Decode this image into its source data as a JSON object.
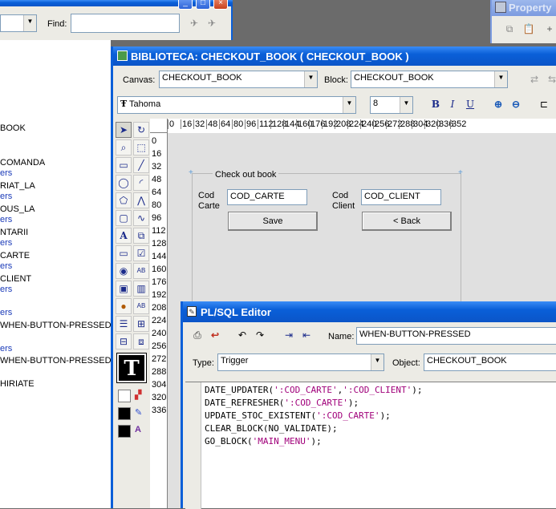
{
  "top_window": {
    "find_label": "Find:",
    "combo_value": "",
    "find_value": ""
  },
  "property_window": {
    "title": "Property"
  },
  "navigator": {
    "items": [
      {
        "text": "BOOK",
        "color": "black"
      },
      {
        "text": "COMANDA",
        "color": "black"
      },
      {
        "text": "ers",
        "color": "blue"
      },
      {
        "text": "RIAT_LA",
        "color": "black"
      },
      {
        "text": "ers",
        "color": "blue"
      },
      {
        "text": "OUS_LA",
        "color": "black"
      },
      {
        "text": "ers",
        "color": "blue"
      },
      {
        "text": "NTARII",
        "color": "black"
      },
      {
        "text": "ers",
        "color": "blue"
      },
      {
        "text": "CARTE",
        "color": "black"
      },
      {
        "text": "ers",
        "color": "blue"
      },
      {
        "text": "CLIENT",
        "color": "black"
      },
      {
        "text": "ers",
        "color": "blue"
      },
      {
        "text": "ers",
        "color": "blue"
      },
      {
        "text": "WHEN-BUTTON-PRESSED",
        "color": "black"
      },
      {
        "text": "ers",
        "color": "blue"
      },
      {
        "text": "WHEN-BUTTON-PRESSED",
        "color": "black"
      },
      {
        "text": "HIRIATE",
        "color": "black"
      }
    ]
  },
  "layout_editor": {
    "title": "BIBLIOTECA: CHECKOUT_BOOK ( CHECKOUT_BOOK )",
    "canvas_label": "Canvas:",
    "canvas_value": "CHECKOUT_BOOK",
    "block_label": "Block:",
    "block_value": "CHECKOUT_BOOK",
    "font_name": "Tahoma",
    "font_size": "8",
    "bold": "B",
    "italic": "I",
    "underline": "U",
    "ruler_h": [
      "0",
      "16",
      "32",
      "48",
      "64",
      "80",
      "96",
      "112",
      "128",
      "144",
      "160",
      "176",
      "192",
      "208",
      "224",
      "240",
      "256",
      "272",
      "288",
      "304",
      "320",
      "336",
      "352"
    ],
    "ruler_v": [
      "0",
      "16",
      "32",
      "48",
      "64",
      "80",
      "96",
      "112",
      "128",
      "144",
      "160",
      "176",
      "192",
      "208",
      "224",
      "240",
      "256",
      "272",
      "288",
      "304",
      "320",
      "336"
    ],
    "form": {
      "frame_title": "Check out book",
      "cod_carte_label_1": "Cod",
      "cod_carte_label_2": "Carte",
      "cod_carte_value": "COD_CARTE",
      "cod_client_label_1": "Cod",
      "cod_client_label_2": "Client",
      "cod_client_value": "COD_CLIENT",
      "save_button": "Save",
      "back_button": "< Back"
    }
  },
  "plsql_editor": {
    "title": "PL/SQL Editor",
    "name_label": "Name:",
    "name_value": "WHEN-BUTTON-PRESSED",
    "type_label": "Type:",
    "type_value": "Trigger",
    "object_label": "Object:",
    "object_value": "CHECKOUT_BOOK",
    "code_lines": [
      [
        {
          "t": "DATE_UPDATER(",
          "s": false
        },
        {
          "t": "':COD_CARTE'",
          "s": true
        },
        {
          "t": ",",
          "s": false
        },
        {
          "t": "':COD_CLIENT'",
          "s": true
        },
        {
          "t": ");",
          "s": false
        }
      ],
      [
        {
          "t": "DATE_REFRESHER(",
          "s": false
        },
        {
          "t": "':COD_CARTE'",
          "s": true
        },
        {
          "t": ");",
          "s": false
        }
      ],
      [
        {
          "t": "UPDATE_STOC_EXISTENT(",
          "s": false
        },
        {
          "t": "':COD_CARTE'",
          "s": true
        },
        {
          "t": ");",
          "s": false
        }
      ],
      [
        {
          "t": "CLEAR_BLOCK(NO_VALIDATE);",
          "s": false
        }
      ],
      [
        {
          "t": "GO_BLOCK(",
          "s": false
        },
        {
          "t": "'MAIN_MENU'",
          "s": true
        },
        {
          "t": ");",
          "s": false
        }
      ]
    ]
  },
  "colors": {
    "xp_title": "#0a5fd8",
    "canvas_bg": "#e0e0e0",
    "string_literal": "#a0007a"
  }
}
